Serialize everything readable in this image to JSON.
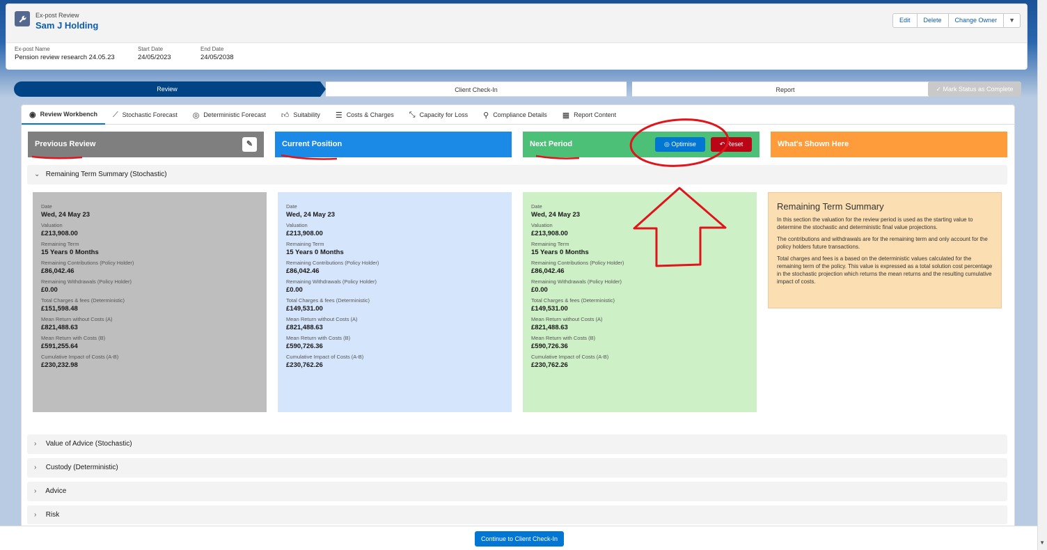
{
  "record": {
    "object_type": "Ex-post Review",
    "name": "Sam J Holding",
    "actions": [
      "Edit",
      "Delete",
      "Change Owner"
    ]
  },
  "fields": [
    {
      "label": "Ex-post Name",
      "value": "Pension review research 24.05.23"
    },
    {
      "label": "Start Date",
      "value": "24/05/2023"
    },
    {
      "label": "End Date",
      "value": "24/05/2038"
    }
  ],
  "path": {
    "stages": [
      "Review",
      "Client Check-In",
      "Report"
    ],
    "mark_complete": "Mark Status as Complete"
  },
  "tabs": [
    "Review Workbench",
    "Stochastic Forecast",
    "Deterministic Forecast",
    "Suitability",
    "Costs & Charges",
    "Capacity for Loss",
    "Compliance Details",
    "Report Content"
  ],
  "columns": {
    "previous": "Previous Review",
    "current": "Current Position",
    "next": "Next Period",
    "shown": "What's Shown Here",
    "optimise": "Optimise",
    "reset": "Reset"
  },
  "colors": {
    "previous": "#7f7f7f",
    "current": "#1b8ae6",
    "next": "#4bc076",
    "shown": "#fe9c3c",
    "optimise": "#0176d3",
    "reset": "#ba0517"
  },
  "sections": {
    "remaining": "Remaining Term Summary (Stochastic)",
    "value_advice": "Value of Advice (Stochastic)",
    "custody": "Custody (Deterministic)",
    "advice": "Advice",
    "risk": "Risk"
  },
  "labels": {
    "date": "Date",
    "valuation": "Valuation",
    "term": "Remaining Term",
    "contributions": "Remaining Contributions (Policy Holder)",
    "withdrawals": "Remaining Withdrawals (Policy Holder)",
    "charges": "Total Charges & fees (Deterministic)",
    "mean_no_costs": "Mean Return without Costs (A)",
    "mean_costs": "Mean Return with Costs (B)",
    "impact": "Cumulative Impact of Costs (A-B)"
  },
  "previous_values": {
    "date": "Wed, 24 May 23",
    "valuation": "£213,908.00",
    "term": "15 Years 0 Months",
    "contributions": "£86,042.46",
    "withdrawals": "£0.00",
    "charges": "£151,598.48",
    "mean_no_costs": "£821,488.63",
    "mean_costs": "£591,255.64",
    "impact": "£230,232.98"
  },
  "current_values": {
    "date": "Wed, 24 May 23",
    "valuation": "£213,908.00",
    "term": "15 Years 0 Months",
    "contributions": "£86,042.46",
    "withdrawals": "£0.00",
    "charges": "£149,531.00",
    "mean_no_costs": "£821,488.63",
    "mean_costs": "£590,726.36",
    "impact": "£230,762.26"
  },
  "next_values": {
    "date": "Wed, 24 May 23",
    "valuation": "£213,908.00",
    "term": "15 Years 0 Months",
    "contributions": "£86,042.46",
    "withdrawals": "£0.00",
    "charges": "£149,531.00",
    "mean_no_costs": "£821,488.63",
    "mean_costs": "£590,726.36",
    "impact": "£230,762.26"
  },
  "info": {
    "title": "Remaining Term Summary",
    "p1": "In this section the valuation for the review period is used as the starting value to determine the stochastic and deterministic final value projections.",
    "p2": "The contributions and withdrawals are for the remaining term and only account for the policy holders future transactions.",
    "p3": "Total charges and fees is a based on the deterministic values calculated for the remaining term of the policy. This value is expressed as a total solution cost percentage in the stochastic projection which returns the mean returns and the resulting cumulative impact of costs."
  },
  "footer": {
    "continue": "Continue to Client Check-In"
  }
}
